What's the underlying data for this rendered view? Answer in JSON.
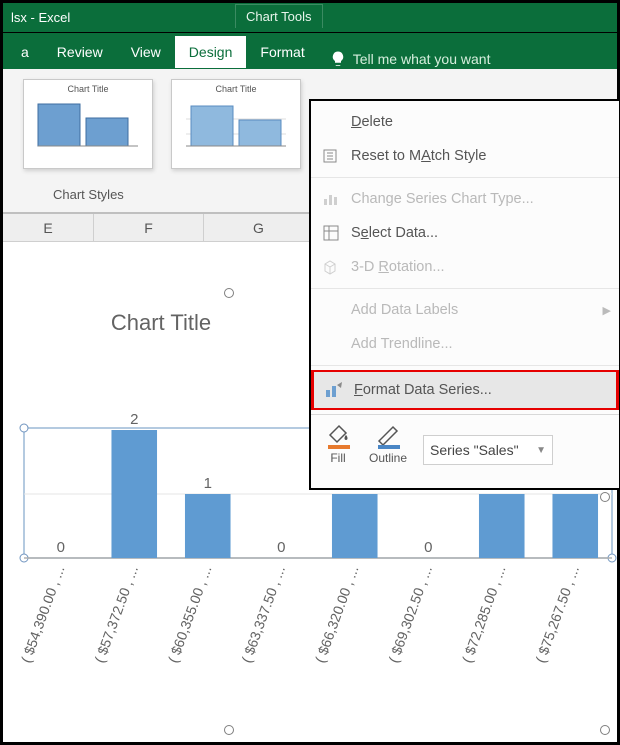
{
  "titlebar": {
    "filename": "lsx - Excel",
    "chart_tools": "Chart Tools"
  },
  "tabs": {
    "items": [
      "a",
      "Review",
      "View",
      "Design",
      "Format"
    ],
    "active_index": 3,
    "tell_me": "Tell me what you want"
  },
  "styles_panel": {
    "label": "Chart Styles",
    "thumbs": [
      {
        "title": "Chart Title"
      },
      {
        "title": "Chart Title"
      }
    ]
  },
  "sheet": {
    "columns": [
      "E",
      "F",
      "G"
    ]
  },
  "chart": {
    "title": "Chart Title"
  },
  "context_menu": {
    "delete": "Delete",
    "delete_m": "D",
    "reset": "Reset to Match Style",
    "reset_m": "A",
    "change_type": "Change Series Chart Type...",
    "select_data": "Select Data...",
    "select_data_m": "e",
    "rotation": "3-D Rotation...",
    "rotation_m": "R",
    "add_labels": "Add Data Labels",
    "add_trendline": "Add Trendline...",
    "format_series": "Format Data Series...",
    "format_series_m": "F",
    "fill_label": "Fill",
    "outline_label": "Outline",
    "series_box": "Series \"Sales\""
  },
  "chart_data": {
    "type": "bar",
    "title": "Chart Title",
    "categories": [
      "( $54,390.00 , ...",
      "( $57,372.50 , ...",
      "( $60,355.00 , ...",
      "( $63,337.50 , ...",
      "( $66,320.00 , ...",
      "( $69,302.50 , ...",
      "( $72,285.00 , ...",
      "( $75,267.50 , ..."
    ],
    "values": [
      0,
      2,
      1,
      0,
      1,
      0,
      1,
      1
    ],
    "xlabel": "",
    "ylabel": "",
    "ylim": [
      0,
      2
    ]
  }
}
